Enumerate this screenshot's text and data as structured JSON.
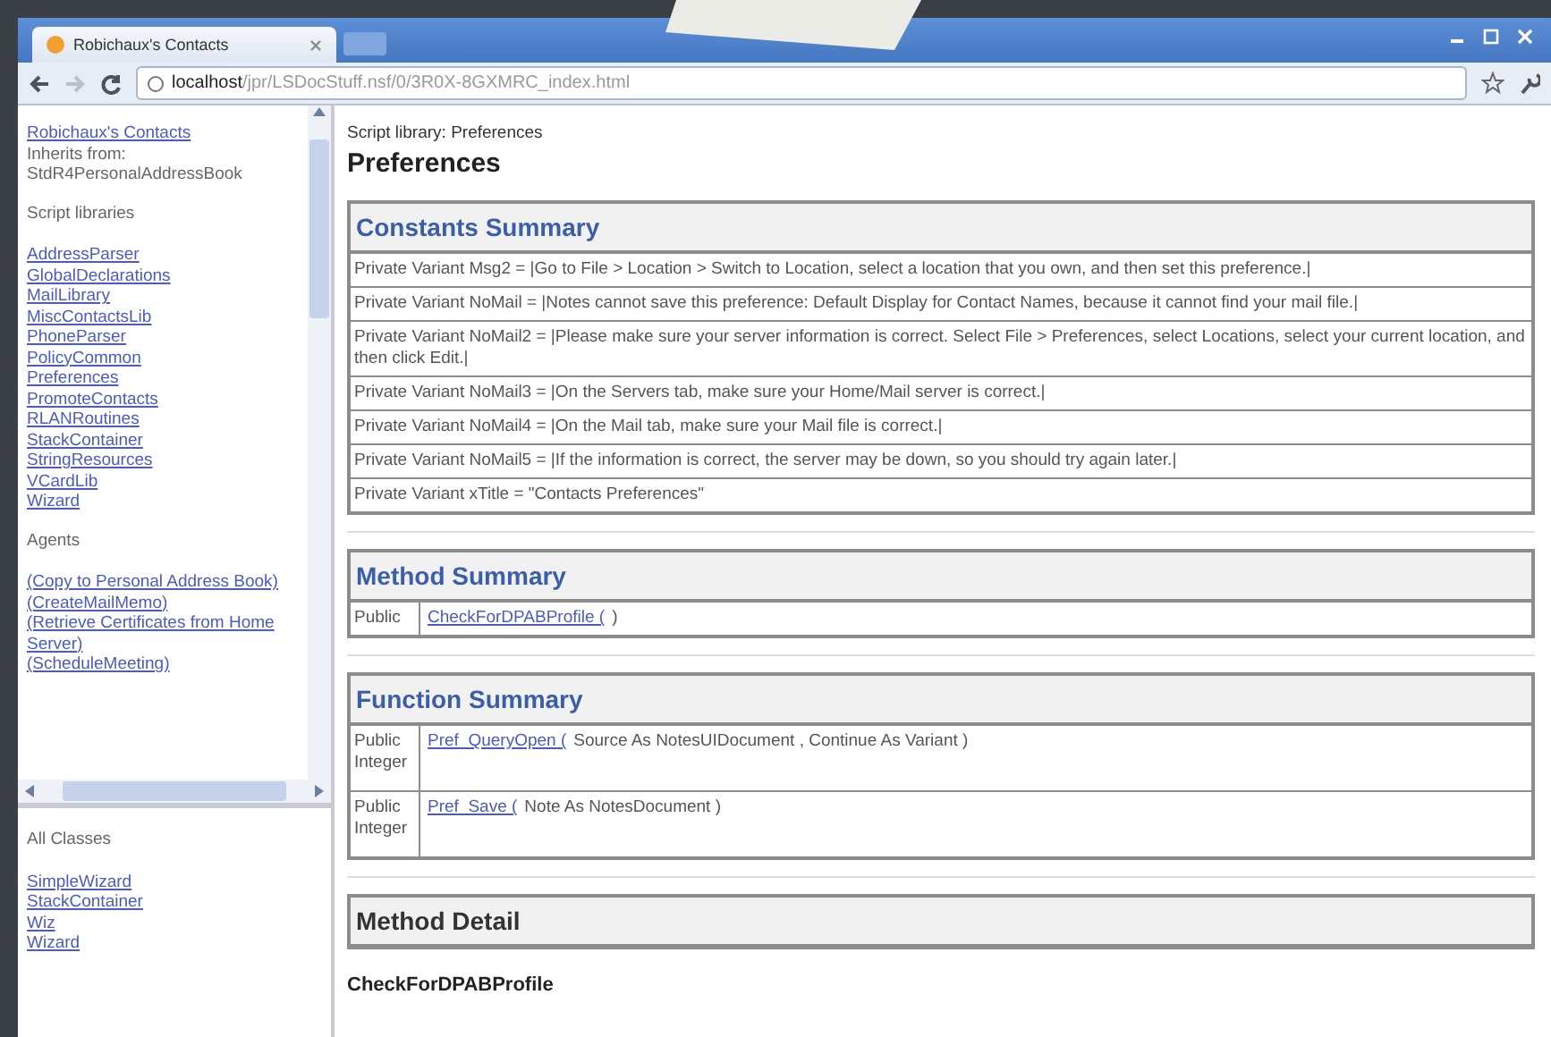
{
  "browser": {
    "tab_title": "Robichaux's Contacts",
    "url_host": "localhost",
    "url_path": "/jpr/LSDocStuff.nsf/0/3R0X-8GXMRC_index.html",
    "forward_disabled": true
  },
  "sidebar": {
    "title_link": "Robichaux's Contacts",
    "inherits_label": "Inherits from:",
    "inherits_value": "StdR4PersonalAddressBook",
    "sections": [
      {
        "title": "Script libraries",
        "links": [
          "AddressParser",
          "GlobalDeclarations",
          "MailLibrary",
          "MiscContactsLib",
          "PhoneParser",
          "PolicyCommon",
          "Preferences",
          "PromoteContacts",
          "RLANRoutines",
          "StackContainer",
          "StringResources",
          "VCardLib",
          "Wizard"
        ]
      },
      {
        "title": "Agents",
        "links": [
          "(Copy to Personal Address Book)",
          "(CreateMailMemo)",
          "(Retrieve Certificates from Home Server)",
          "(ScheduleMeeting)"
        ]
      }
    ]
  },
  "classes": {
    "title": "All Classes",
    "links": [
      "SimpleWizard",
      "StackContainer",
      "Wiz",
      "Wizard"
    ]
  },
  "main": {
    "breadcrumb": "Script library: Preferences",
    "heading": "Preferences",
    "constants": {
      "title": "Constants Summary",
      "rows": [
        "Private Variant Msg2 = |Go to File > Location > Switch to Location, select a location that you own, and then set this preference.|",
        "Private Variant NoMail = |Notes cannot save this preference: Default Display for Contact Names, because it cannot find your mail file.|",
        "Private Variant NoMail2 = |Please make sure your server information is correct. Select File > Preferences, select Locations, select your current location, and then click Edit.|",
        "Private Variant NoMail3 = |On the Servers tab, make sure your Home/Mail server is correct.|",
        "Private Variant NoMail4 = |On the Mail tab, make sure your Mail file is correct.|",
        "Private Variant NoMail5 = |If the information is correct, the server may be down, so you should try again later.|",
        "Private Variant xTitle = \"Contacts Preferences\""
      ]
    },
    "methods": {
      "title": "Method Summary",
      "rows": [
        {
          "modifier": "Public",
          "link": "CheckForDPABProfile (",
          "signature": ")"
        }
      ]
    },
    "functions": {
      "title": "Function Summary",
      "rows": [
        {
          "modifier": "Public Integer",
          "link": "Pref_QueryOpen (",
          "signature": "Source As NotesUIDocument , Continue As Variant )"
        },
        {
          "modifier": "Public Integer",
          "link": "Pref_Save (",
          "signature": "Note As NotesDocument )"
        }
      ]
    },
    "detail": {
      "title": "Method Detail",
      "item": "CheckForDPABProfile"
    }
  }
}
